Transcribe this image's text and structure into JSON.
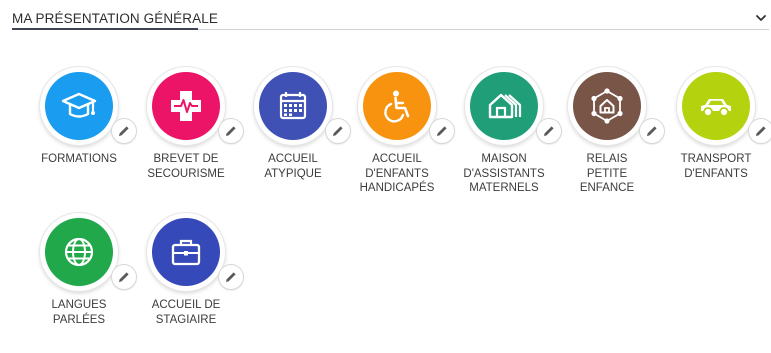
{
  "section": {
    "title": "MA PRÉSENTATION GÉNÉRALE",
    "chevron_icon": "chevron-down-icon"
  },
  "items": [
    {
      "label": "FORMATIONS",
      "color": "#1a9cf0",
      "icon": "graduation-cap-icon"
    },
    {
      "label": "BREVET DE\nSECOURISME",
      "color": "#ec1467",
      "icon": "medical-cross-icon"
    },
    {
      "label": "ACCUEIL\nATYPIQUE",
      "color": "#3f51b5",
      "icon": "calendar-icon"
    },
    {
      "label": "ACCUEIL\nD'ENFANTS\nHANDICAPÉS",
      "color": "#f7930f",
      "icon": "wheelchair-icon"
    },
    {
      "label": "MAISON\nD'ASSISTANTS\nMATERNELS",
      "color": "#1f9e77",
      "icon": "houses-icon"
    },
    {
      "label": "RELAIS\nPETITE\nENFANCE",
      "color": "#795548",
      "icon": "network-house-icon"
    },
    {
      "label": "TRANSPORT\nD'ENFANTS",
      "color": "#b5d20f",
      "icon": "car-icon"
    },
    {
      "label": "LANGUES\nPARLÉES",
      "color": "#20a84a",
      "icon": "globe-icon"
    },
    {
      "label": "ACCUEIL DE\nSTAGIAIRE",
      "color": "#3549b8",
      "icon": "briefcase-icon"
    }
  ],
  "edit_icon": "pencil-icon"
}
